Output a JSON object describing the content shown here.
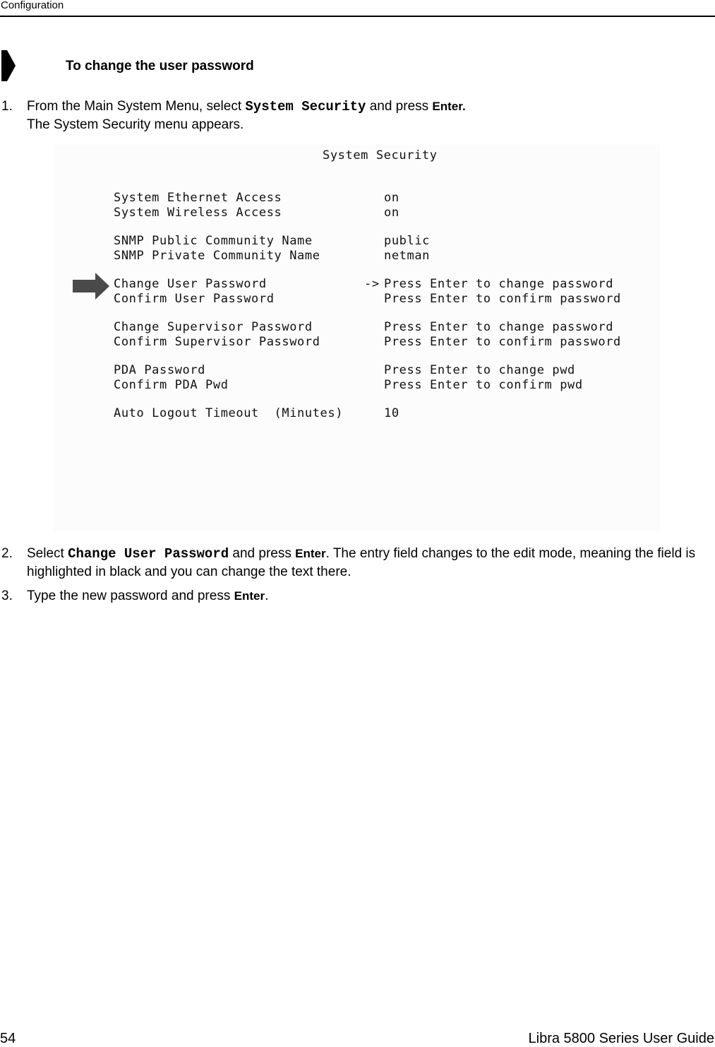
{
  "header": {
    "section_title": "Configuration"
  },
  "procedure": {
    "icon": "procedure-arrow-icon",
    "heading": "To change the user password"
  },
  "steps": [
    {
      "number": "1.",
      "text_before": "From the Main System Menu, select ",
      "code": "System Security",
      "text_middle": " and press ",
      "key": "Enter.",
      "text_after": "",
      "result": "The System Security menu appears."
    },
    {
      "number": "2.",
      "text_before": "Select ",
      "code": "Change User Password",
      "text_middle": " and press ",
      "key": "Enter",
      "text_after": ". The entry field changes to the edit mode, meaning the field is highlighted in black and you can change the text there."
    },
    {
      "number": "3.",
      "text_before": "Type the new password and press ",
      "key": "Enter",
      "text_after": "."
    }
  ],
  "screenshot": {
    "title": "System Security",
    "pointer_icon": "right-arrow-pointer-icon",
    "cursor_marker": "->",
    "rows": [
      {
        "label": "System Ethernet Access",
        "value": "on"
      },
      {
        "label": "System Wireless Access",
        "value": "on"
      },
      {
        "label": "SNMP Public Community Name",
        "value": "public"
      },
      {
        "label": "SNMP Private Community Name",
        "value": "netman"
      },
      {
        "label": "Change User Password",
        "value": "Press Enter to change password",
        "selected": true
      },
      {
        "label": "Confirm User Password",
        "value": "Press Enter to confirm password"
      },
      {
        "label": "Change Supervisor Password",
        "value": "Press Enter to change password"
      },
      {
        "label": "Confirm Supervisor Password",
        "value": "Press Enter to confirm password"
      },
      {
        "label": "PDA Password",
        "value": "Press Enter to change pwd"
      },
      {
        "label": "Confirm PDA Pwd",
        "value": "Press Enter to confirm pwd"
      },
      {
        "label": "Auto Logout Timeout  (Minutes)",
        "value": "10"
      }
    ]
  },
  "footer": {
    "page_number": "54",
    "doc_title": "Libra 5800 Series User Guide"
  }
}
